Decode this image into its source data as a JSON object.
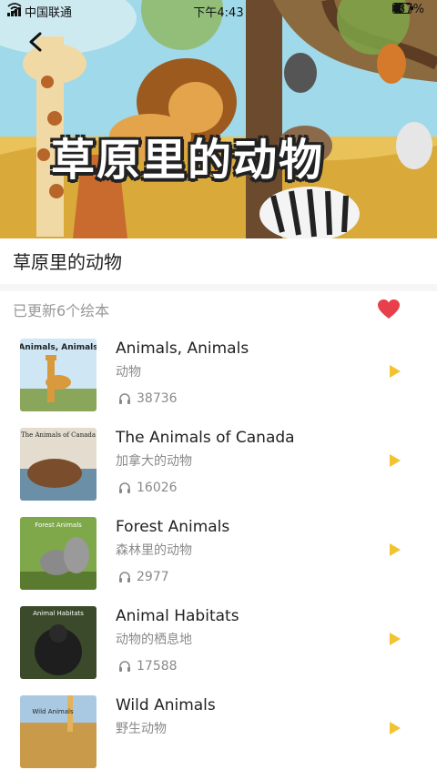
{
  "status_bar": {
    "carrier": "中国联通",
    "time": "下午4:43",
    "battery": "37%"
  },
  "hero": {
    "title": "草原里的动物"
  },
  "page": {
    "title": "草原里的动物",
    "count_label": "已更新6个绘本"
  },
  "colors": {
    "accent": "#e8404a",
    "play": "#f2c230",
    "muted": "#999999"
  },
  "items": [
    {
      "title": "Animals, Animals",
      "subtitle": "动物",
      "plays": "38736",
      "cover_text": "Animals, Animals"
    },
    {
      "title": "The Animals of Canada",
      "subtitle": "加拿大的动物",
      "plays": "16026",
      "cover_text": "The Animals of Canada"
    },
    {
      "title": "Forest Animals",
      "subtitle": "森林里的动物",
      "plays": "2977",
      "cover_text": "Forest Animals"
    },
    {
      "title": "Animal Habitats",
      "subtitle": "动物的栖息地",
      "plays": "17588",
      "cover_text": "Animal Habitats"
    },
    {
      "title": "Wild Animals",
      "subtitle": "野生动物",
      "plays": "",
      "cover_text": "Wild Animals"
    }
  ]
}
